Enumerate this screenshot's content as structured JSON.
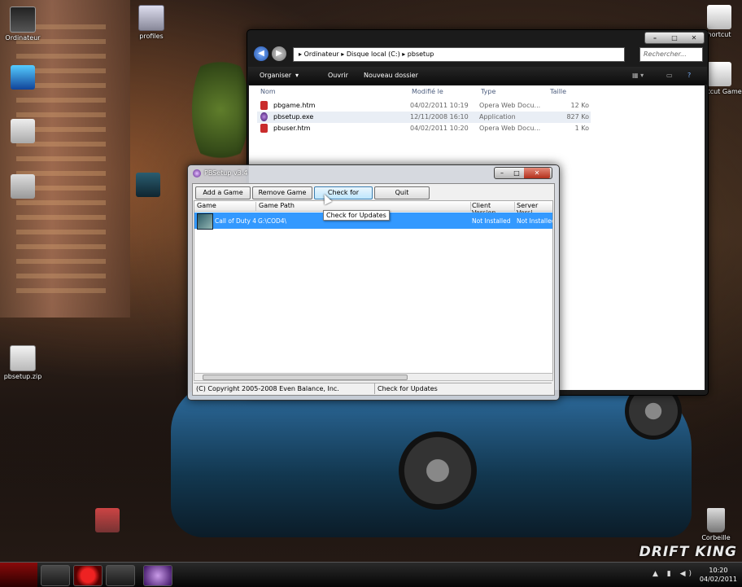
{
  "desktop": {
    "icons": [
      {
        "label": "Ordinateur"
      },
      {
        "label": "profiles"
      },
      {
        "label": "pbsetup.zip"
      },
      {
        "label": "Corbeille"
      },
      {
        "label": "hortcut"
      },
      {
        "label": "hortcut Game"
      }
    ],
    "wallpaper_text": "DRIFT KING"
  },
  "explorer": {
    "breadcrumb": [
      "Ordinateur",
      "Disque local (C:)",
      "pbsetup"
    ],
    "search_placeholder": "Rechercher...",
    "toolbar": {
      "organize": "Organiser",
      "open": "Ouvrir",
      "new_folder": "Nouveau dossier"
    },
    "columns": {
      "name": "Nom",
      "modified": "Modifié le",
      "type": "Type",
      "size": "Taille"
    },
    "files": [
      {
        "name": "pbgame.htm",
        "modified": "04/02/2011 10:19",
        "type": "Opera Web Docu...",
        "size": "12 Ko"
      },
      {
        "name": "pbsetup.exe",
        "modified": "12/11/2008 16:10",
        "type": "Application",
        "size": "827 Ko"
      },
      {
        "name": "pbuser.htm",
        "modified": "04/02/2011 10:20",
        "type": "Opera Web Docu...",
        "size": "1 Ko"
      }
    ],
    "selected_file_index": 1
  },
  "pbsetup": {
    "title": "PBSetup v3.4",
    "buttons": {
      "add": "Add a Game",
      "remove": "Remove Game",
      "check": "Check for Updates",
      "quit": "Quit"
    },
    "columns": {
      "game": "Game",
      "path": "Game Path",
      "client": "Client Version",
      "server": "Server Versi"
    },
    "rows": [
      {
        "game": "Call of Duty 4",
        "path": "G:\\COD4\\",
        "client": "Not Installed",
        "server": "Not Installed"
      }
    ],
    "status_left": "(C) Copyright 2005-2008 Even Balance, Inc.",
    "status_right": "Check for Updates",
    "tooltip": "Check for Updates"
  },
  "taskbar": {
    "time": "10:20",
    "date": "04/02/2011"
  }
}
